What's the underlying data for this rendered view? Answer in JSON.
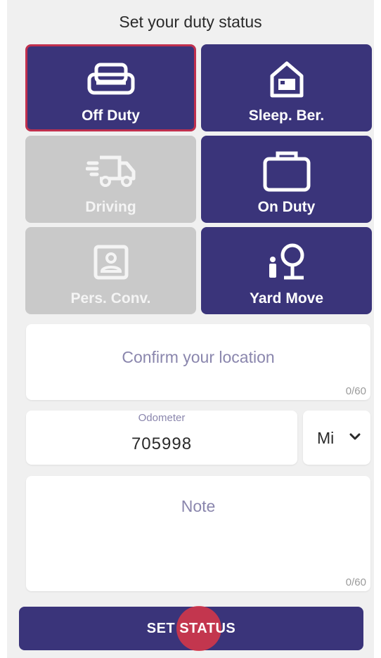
{
  "header": {
    "title": "Set your duty status"
  },
  "statuses": [
    {
      "label": "Off Duty",
      "icon": "sofa-icon",
      "state": "selected"
    },
    {
      "label": "Sleep. Ber.",
      "icon": "sleeper-berth-icon",
      "state": "active"
    },
    {
      "label": "Driving",
      "icon": "truck-icon",
      "state": "disabled"
    },
    {
      "label": "On Duty",
      "icon": "briefcase-icon",
      "state": "active"
    },
    {
      "label": "Pers. Conv.",
      "icon": "person-portrait-icon",
      "state": "disabled"
    },
    {
      "label": "Yard Move",
      "icon": "yard-tree-icon",
      "state": "active"
    }
  ],
  "location": {
    "placeholder": "Confirm your location",
    "counter": "0/60"
  },
  "odometer": {
    "label": "Odometer",
    "value": "705998",
    "unit": "Mi"
  },
  "note": {
    "placeholder": "Note",
    "counter": "0/60"
  },
  "submit": {
    "label": "SET STATUS"
  },
  "colors": {
    "accent": "#3a347a",
    "disabled": "#c9c9c9",
    "selected_border": "#c0304e",
    "ripple": "#dc3746"
  }
}
